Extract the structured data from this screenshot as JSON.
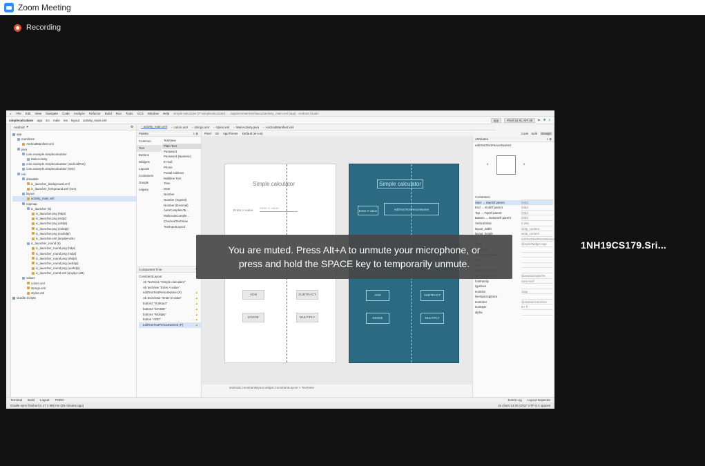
{
  "window": {
    "title": "Zoom Meeting",
    "accent": "#2d8cff"
  },
  "recording": {
    "label": "Recording",
    "color": "#d9532c"
  },
  "participant": {
    "name": "1NH19CS179.Sri..."
  },
  "toast": {
    "line1": "You are muted. Press Alt+A to unmute your microphone, or",
    "line2": "press and hold the SPACE key to temporarily unmute."
  },
  "studio": {
    "menu": [
      "File",
      "Edit",
      "View",
      "Navigate",
      "Code",
      "Analyze",
      "Refactor",
      "Build",
      "Run",
      "Tools",
      "VCS",
      "Window",
      "Help"
    ],
    "title_text": "simple-calculator [F:\\simplecalculator] - ...\\app\\src\\main\\res\\layout\\activity_main.xml [app] - Android Studio",
    "breadcrumb": [
      "simplecalculator",
      "app",
      "src",
      "main",
      "res",
      "layout",
      "activity_main.xml"
    ],
    "run_config": "app",
    "device": "Pixel 2a XL API 30",
    "project_view": "Android",
    "tree": [
      {
        "label": "app",
        "indent": 0
      },
      {
        "label": "manifests",
        "indent": 1
      },
      {
        "label": "AndroidManifest.xml",
        "indent": 2
      },
      {
        "label": "java",
        "indent": 1
      },
      {
        "label": "com.example.simplecalculator",
        "indent": 2
      },
      {
        "label": "MainActivity",
        "indent": 3
      },
      {
        "label": "com.example.simplecalculator (androidTest)",
        "indent": 2
      },
      {
        "label": "com.example.simplecalculator (test)",
        "indent": 2
      },
      {
        "label": "res",
        "indent": 1
      },
      {
        "label": "drawable",
        "indent": 2
      },
      {
        "label": "ic_launcher_background.xml",
        "indent": 3
      },
      {
        "label": "ic_launcher_foreground.xml (v24)",
        "indent": 3
      },
      {
        "label": "layout",
        "indent": 2
      },
      {
        "label": "activity_main.xml",
        "indent": 3,
        "selected": true
      },
      {
        "label": "mipmap",
        "indent": 2
      },
      {
        "label": "ic_launcher (6)",
        "indent": 3
      },
      {
        "label": "ic_launcher.png (hdpi)",
        "indent": 4
      },
      {
        "label": "ic_launcher.png (mdpi)",
        "indent": 4
      },
      {
        "label": "ic_launcher.png (xhdpi)",
        "indent": 4
      },
      {
        "label": "ic_launcher.png (xxhdpi)",
        "indent": 4
      },
      {
        "label": "ic_launcher.png (xxxhdpi)",
        "indent": 4
      },
      {
        "label": "ic_launcher.xml (anydpi-v26)",
        "indent": 4
      },
      {
        "label": "ic_launcher_round (6)",
        "indent": 3
      },
      {
        "label": "ic_launcher_round.png (hdpi)",
        "indent": 4
      },
      {
        "label": "ic_launcher_round.png (mdpi)",
        "indent": 4
      },
      {
        "label": "ic_launcher_round.png (xhdpi)",
        "indent": 4
      },
      {
        "label": "ic_launcher_round.png (xxhdpi)",
        "indent": 4
      },
      {
        "label": "ic_launcher_round.png (xxxhdpi)",
        "indent": 4
      },
      {
        "label": "ic_launcher_round.xml (anydpi-v26)",
        "indent": 4
      },
      {
        "label": "values",
        "indent": 2
      },
      {
        "label": "colors.xml",
        "indent": 3
      },
      {
        "label": "strings.xml",
        "indent": 3
      },
      {
        "label": "styles.xml",
        "indent": 3
      },
      {
        "label": "Gradle Scripts",
        "indent": 0
      }
    ],
    "editor_tabs": [
      "activity_main.xml",
      "colors.xml",
      "strings.xml",
      "styles.xml",
      "MainActivity.java",
      "AndroidManifest.xml"
    ],
    "modes": [
      "Code",
      "Split",
      "Design"
    ],
    "palette": {
      "title": "Palette",
      "categories": [
        "Common",
        "Text",
        "Buttons",
        "Widgets",
        "Layouts",
        "Containers",
        "Google",
        "Legacy"
      ],
      "items": [
        "TextView",
        "Plain Text",
        "Password",
        "Password (Numeric)",
        "E-mail",
        "Phone",
        "Postal Address",
        "Multiline Text",
        "Time",
        "Date",
        "Number",
        "Number (Signed)",
        "Number (Decimal)",
        "AutoCompleteTe...",
        "MultiAutoComple...",
        "CheckedTextView",
        "TextInputLayout"
      ]
    },
    "component_tree": {
      "title": "Component Tree",
      "rows": [
        "ConstraintLayout",
        "Ab TextView \"Simple calculator\"",
        "Ab textView \"Enter A value\"",
        "editTextTextPersonName (P)",
        "Ab textView2 \"Enter B value\"",
        "button2 \"Subtract\"",
        "button3 \"DIVIDE\"",
        "button4 \"Multiply\"",
        "button \"ADD\"",
        "editTextTextPersonName3 (P)"
      ]
    },
    "design_toolbar": [
      "Pixel",
      "28",
      "AppTheme",
      "Default (en-us)"
    ],
    "preview": {
      "title": "Simple calculator",
      "label_a": "Enter A value",
      "hint": "enter A value",
      "buttons": [
        "ADD",
        "SUBTRACT",
        "DIVIDE",
        "MULTIPLY"
      ]
    },
    "blueprint_label": "editTextTextPersonName",
    "attributes": {
      "title": "Attributes",
      "selected": "editTextTextPersonName2",
      "constraint_value": "0",
      "rows": [
        {
          "k": "Constraints",
          "v": ""
        },
        {
          "k": "Start → StartOf parent",
          "v": "(0dp)"
        },
        {
          "k": "End → EndOf parent",
          "v": "(0dp)"
        },
        {
          "k": "Top → TopOf parent",
          "v": "(0dp)"
        },
        {
          "k": "Bottom → BottomOf parent",
          "v": "(0dp)"
        },
        {
          "k": "Vertical Bias",
          "v": "0.250"
        },
        {
          "k": "layout_width",
          "v": "wrap_content"
        },
        {
          "k": "layout_height",
          "v": "wrap_content"
        },
        {
          "k": "id",
          "v": "editTextTextPersonName"
        },
        {
          "k": "style",
          "v": "@style/Widget.App"
        },
        {
          "k": "singleLine",
          "v": ""
        },
        {
          "k": "selectAllOnFocus",
          "v": ""
        },
        {
          "k": "text",
          "v": ""
        },
        {
          "k": "text",
          "v": ""
        },
        {
          "k": "contentDescripti...",
          "v": ""
        },
        {
          "k": "textAppearance",
          "v": "@android:style/Te"
        },
        {
          "k": "fontFamily",
          "v": "sans-serif"
        },
        {
          "k": "typeface",
          "v": ""
        },
        {
          "k": "textSize",
          "v": "18sp"
        },
        {
          "k": "lineSpacingExtra",
          "v": ""
        },
        {
          "k": "textColor",
          "v": "@android:color/sec"
        },
        {
          "k": "textStyle",
          "v": "B I Tr"
        },
        {
          "k": "alpha",
          "v": ""
        }
      ]
    },
    "bottom_tools": [
      "Terminal",
      "Build",
      "Logcat",
      "TODO"
    ],
    "bottom_right": [
      "Event Log",
      "Layout Inspector"
    ],
    "status": "Gradle sync finished in 17 s 980 ms (25 minutes ago)",
    "status_right": "15 chars  13:26  CRLF  UTF-8  4 spaces",
    "crumbtext": "androidx.constraintlayout.widget.ConstraintLayout > TextView"
  }
}
